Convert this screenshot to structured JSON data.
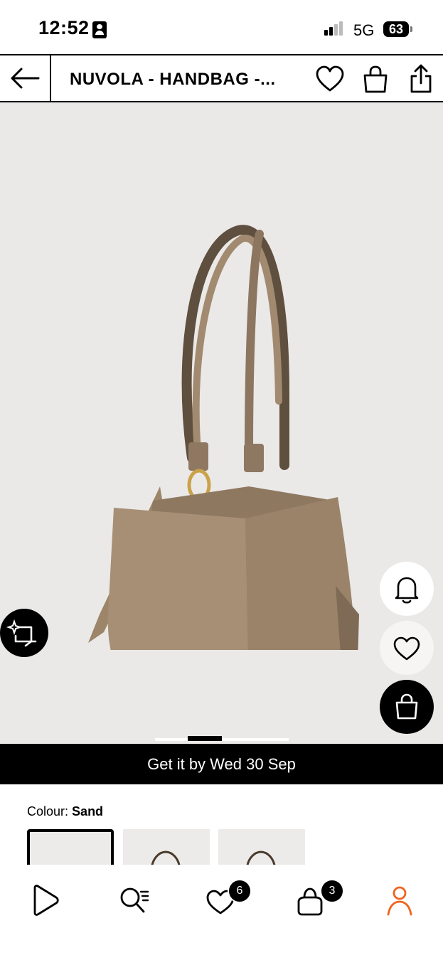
{
  "status_bar": {
    "time": "12:52",
    "network": "5G",
    "battery": "63"
  },
  "header": {
    "title": "NUVOLA - HANDBAG -...",
    "back_icon": "arrow-left-icon",
    "icons": [
      "heart-icon",
      "shopping-bag-icon",
      "share-icon"
    ]
  },
  "product": {
    "image": "sand-leather-handbag",
    "image_page_indicator": {
      "active": 1,
      "total": 4
    },
    "actions": [
      "bell-icon",
      "heart-icon",
      "shopping-bag-icon"
    ],
    "visual_search_icon": "sparkle-crop-icon"
  },
  "delivery": {
    "text": "Get it by Wed 30 Sep"
  },
  "colour": {
    "label": "Colour:",
    "value": "Sand",
    "swatches": 3,
    "selected": 0
  },
  "tabbar": {
    "items": [
      {
        "name": "home",
        "icon": "play-logo-icon"
      },
      {
        "name": "search",
        "icon": "search-list-icon"
      },
      {
        "name": "wishlist",
        "icon": "heart-icon",
        "badge": "6"
      },
      {
        "name": "bag",
        "icon": "bag-icon",
        "badge": "3"
      },
      {
        "name": "account",
        "icon": "person-icon"
      }
    ]
  },
  "colors": {
    "accent": "#f0641e",
    "bag": "#a48d74",
    "background": "#ebe9e7"
  }
}
